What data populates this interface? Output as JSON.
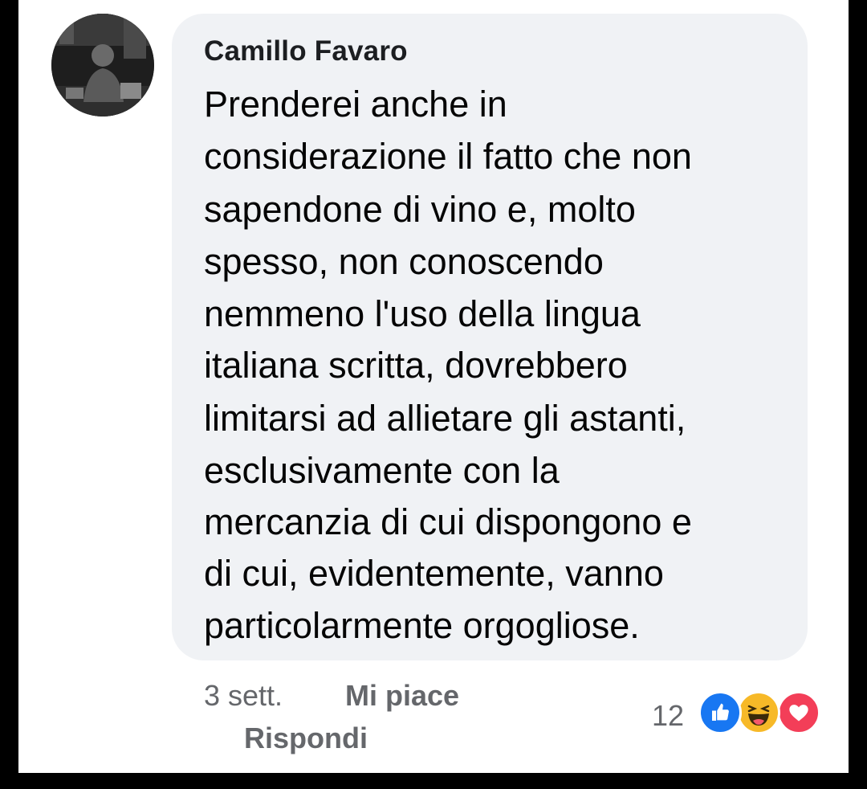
{
  "comment": {
    "author": "Camillo Favaro",
    "text_lines": [
      "Prenderei anche in",
      "considerazione il fatto che non",
      "sapendone di vino e, molto",
      "spesso, non conoscendo",
      "nemmeno l'uso della lingua",
      "italiana scritta, dovrebbero",
      "limitarsi ad allietare gli astanti,",
      "esclusivamente con la",
      "mercanzia di cui dispongono e",
      "di cui, evidentemente, vanno",
      "particolarmente orgogliose."
    ],
    "timestamp": "3 sett.",
    "like_label": "Mi piace",
    "reply_label": "Rispondi",
    "reaction_count": "12",
    "reaction_icons": [
      "like-icon",
      "haha-icon",
      "love-icon"
    ]
  },
  "colors": {
    "bubble_bg": "#f0f2f5",
    "text": "#050505",
    "meta_text": "#65676b",
    "like_blue": "#1877f2",
    "haha_yellow": "#f7b928",
    "love_red": "#f33e58"
  }
}
